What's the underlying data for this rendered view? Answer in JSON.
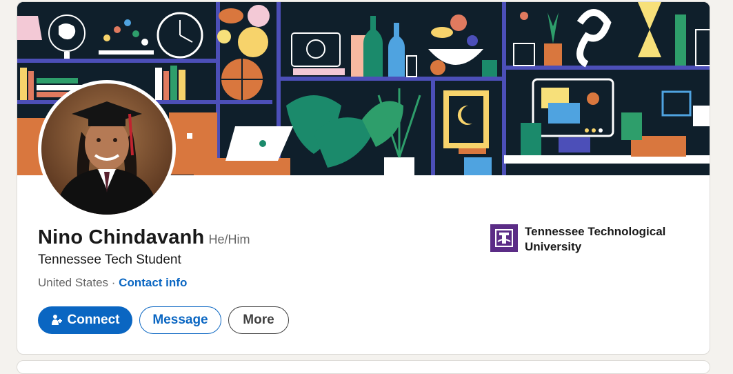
{
  "profile": {
    "name": "Nino Chindavanh",
    "pronouns": "He/Him",
    "headline": "Tennessee Tech Student",
    "location": "United States",
    "separator": " · ",
    "contact_label": "Contact info"
  },
  "actions": {
    "connect_label": "Connect",
    "message_label": "Message",
    "more_label": "More"
  },
  "education": {
    "org_name": "Tennessee Technological University"
  },
  "colors": {
    "accent": "#0a66c2",
    "org_purple": "#5b2c86",
    "banner_bg": "#0f1f2b"
  },
  "icons": {
    "connect": "add-person-icon",
    "org": "university-logo-icon"
  }
}
